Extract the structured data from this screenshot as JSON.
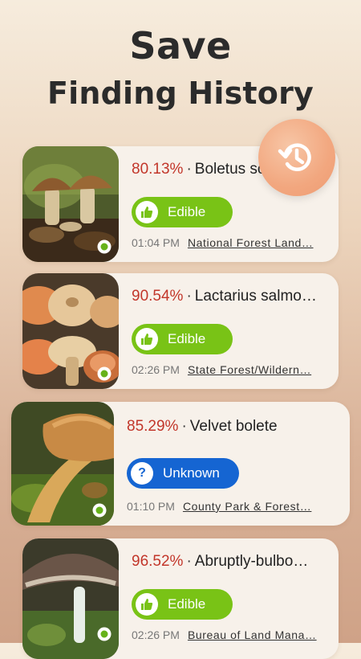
{
  "header": {
    "title": "Save",
    "subtitle": "Finding History"
  },
  "colors": {
    "percent": "#c2362a",
    "edible": "#79c316",
    "unknown": "#1565d2",
    "fab": "#f2a77f"
  },
  "history": [
    {
      "percent": "80.13%",
      "name": "Boletus so",
      "status": "Edible",
      "time": "01:04 PM",
      "location": "National Forest Land…",
      "status_icon": "thumbs-up-icon"
    },
    {
      "percent": "90.54%",
      "name": "Lactarius salmo…",
      "status": "Edible",
      "time": "02:26 PM",
      "location": "State Forest/Wildern…",
      "status_icon": "thumbs-up-icon"
    },
    {
      "percent": "85.29%",
      "name": "Velvet bolete",
      "status": "Unknown",
      "time": "01:10 PM",
      "location": "County Park & Forest…",
      "status_icon": "question-icon"
    },
    {
      "percent": "96.52%",
      "name": "Abruptly-bulbo…",
      "status": "Edible",
      "time": "02:26 PM",
      "location": "Bureau of Land Mana…",
      "status_icon": "thumbs-up-icon"
    }
  ],
  "separator": "·"
}
